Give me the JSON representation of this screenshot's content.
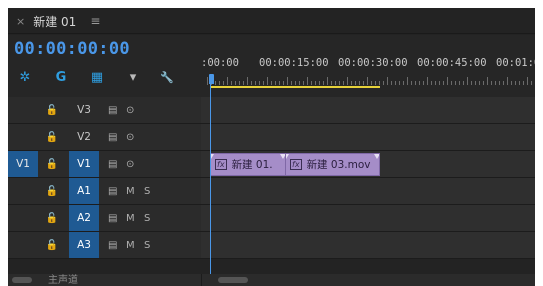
{
  "tab": {
    "close_glyph": "×",
    "title": "新建 01",
    "menu_glyph": "≡"
  },
  "timecode": "00:00:00:00",
  "tools": [
    {
      "name": "snap-icon",
      "glyph": "✲",
      "color": "#2f9ee0"
    },
    {
      "name": "linked-selection-icon",
      "glyph": "G",
      "color": "#2f9ee0"
    },
    {
      "name": "insert-edit-icon",
      "glyph": "▦",
      "color": "#2f9ee0"
    },
    {
      "name": "add-marker-icon",
      "glyph": "▾",
      "color": "#b9b9b9"
    },
    {
      "name": "wrench-icon",
      "glyph": "🔧",
      "color": "#b9b9b9"
    }
  ],
  "ruler": {
    "labels": [
      ":00:00",
      "00:00:15:00",
      "00:00:30:00",
      "00:00:45:00",
      "00:01:0"
    ]
  },
  "tracks": [
    {
      "id": "v3",
      "source": "",
      "lock": "🔓",
      "name": "V3",
      "targeted": false,
      "icons": [
        "▤",
        "⊙"
      ]
    },
    {
      "id": "v2",
      "source": "",
      "lock": "🔓",
      "name": "V2",
      "targeted": false,
      "icons": [
        "▤",
        "⊙"
      ]
    },
    {
      "id": "v1",
      "source": "V1",
      "lock": "🔓",
      "name": "V1",
      "targeted": true,
      "icons": [
        "▤",
        "⊙"
      ]
    },
    {
      "id": "a1",
      "source": "",
      "lock": "🔓",
      "name": "A1",
      "targeted": true,
      "icons": [
        "▤",
        "M",
        "S"
      ]
    },
    {
      "id": "a2",
      "source": "",
      "lock": "🔓",
      "name": "A2",
      "targeted": true,
      "icons": [
        "▤",
        "M",
        "S"
      ]
    },
    {
      "id": "a3",
      "source": "",
      "lock": "🔓",
      "name": "A3",
      "targeted": true,
      "icons": [
        "▤",
        "M",
        "S"
      ]
    }
  ],
  "clips": [
    {
      "fx": "fx",
      "label": "新建 01.",
      "track": "v1"
    },
    {
      "fx": "fx",
      "label": "新建 03.mov",
      "track": "v1"
    }
  ],
  "master_partial": "主声道"
}
